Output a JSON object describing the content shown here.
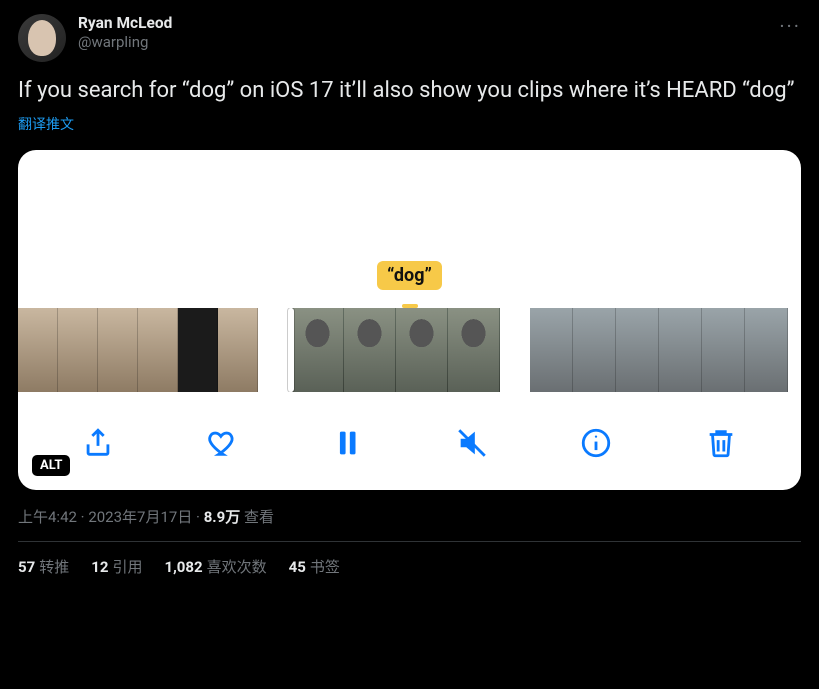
{
  "user": {
    "display_name": "Ryan McLeod",
    "handle": "@warpling"
  },
  "more_label": "···",
  "body": "If you search for “dog” on iOS 17 it’ll also show you clips where it’s HEARD “dog”",
  "translate": "翻译推文",
  "media": {
    "caption": "“dog”",
    "alt_badge": "ALT"
  },
  "meta": {
    "time": "上午4:42",
    "sep1": " · ",
    "date": "2023年7月17日",
    "sep2": " · ",
    "views_count": "8.9万",
    "views_label": " 查看"
  },
  "stats": {
    "retweets": {
      "count": "57",
      "label": "转推"
    },
    "quotes": {
      "count": "12",
      "label": "引用"
    },
    "likes": {
      "count": "1,082",
      "label": "喜欢次数"
    },
    "bookmarks": {
      "count": "45",
      "label": "书签"
    }
  }
}
